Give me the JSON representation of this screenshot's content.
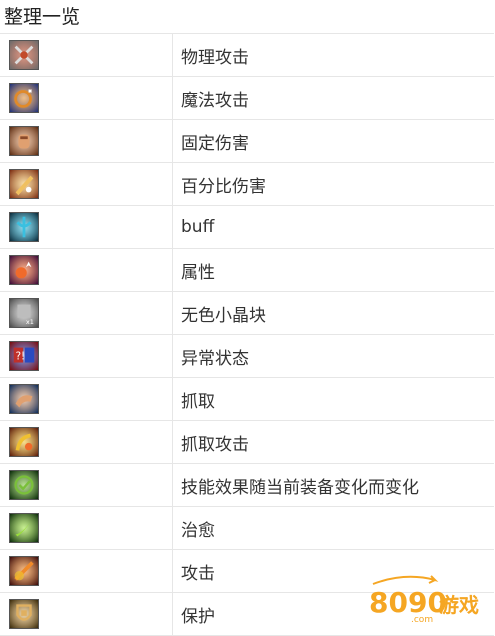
{
  "title": "整理一览",
  "rows": [
    {
      "icon": "physical-attack-icon",
      "label": "物理攻击",
      "colors": [
        "#6b6b6b",
        "#c24a2a"
      ]
    },
    {
      "icon": "magic-attack-icon",
      "label": "魔法攻击",
      "colors": [
        "#1b2f7a",
        "#e08a2a"
      ]
    },
    {
      "icon": "fixed-damage-icon",
      "label": "固定伤害",
      "colors": [
        "#5a2a10",
        "#e0a070"
      ]
    },
    {
      "icon": "percent-damage-icon",
      "label": "百分比伤害",
      "colors": [
        "#7a2a10",
        "#f0c060"
      ]
    },
    {
      "icon": "buff-icon",
      "label": "buff",
      "colors": [
        "#0a2a3a",
        "#3ac0e0"
      ]
    },
    {
      "icon": "attribute-icon",
      "label": "属性",
      "colors": [
        "#3a0a3a",
        "#f06a2a"
      ]
    },
    {
      "icon": "colorless-crystal-icon",
      "label": "无色小晶块",
      "colors": [
        "#4a4a4a",
        "#bdbdbd"
      ]
    },
    {
      "icon": "abnormal-status-icon",
      "label": "异常状态",
      "colors": [
        "#7a0a0a",
        "#2a4ac0"
      ]
    },
    {
      "icon": "grab-icon",
      "label": "抓取",
      "colors": [
        "#0a2a5a",
        "#e0a070"
      ]
    },
    {
      "icon": "grab-attack-icon",
      "label": "抓取攻击",
      "colors": [
        "#5a1a0a",
        "#f0c030"
      ]
    },
    {
      "icon": "skill-effect-change-icon",
      "label": "技能效果随当前装备变化而变化",
      "colors": [
        "#0a2a0a",
        "#7ac03a"
      ]
    },
    {
      "icon": "heal-icon",
      "label": "治愈",
      "colors": [
        "#0a2a0a",
        "#9ae03a"
      ]
    },
    {
      "icon": "attack-icon",
      "label": "攻击",
      "colors": [
        "#3a0a0a",
        "#f08a2a"
      ]
    },
    {
      "icon": "protect-icon",
      "label": "保护",
      "colors": [
        "#3a2a0a",
        "#e0b060"
      ]
    }
  ],
  "watermark": {
    "text": "8090游戏",
    "domain": ".com",
    "color_primary": "#f5a623",
    "color_secondary": "#5a8fd6"
  }
}
